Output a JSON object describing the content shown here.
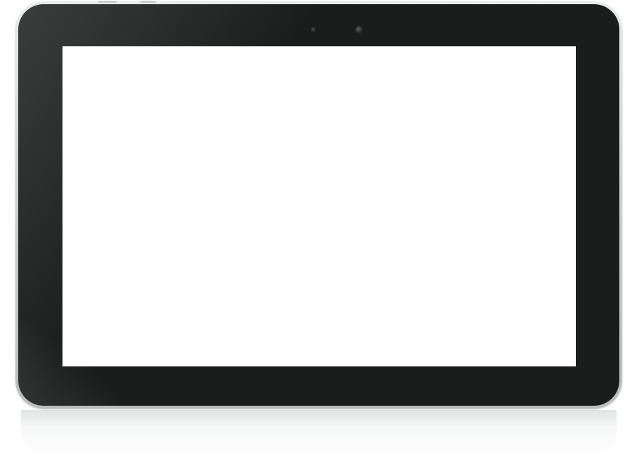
{
  "device": {
    "type": "tablet",
    "orientation": "landscape",
    "frame_color": "#c9cdcc",
    "bezel_color": "#1b1d1c",
    "screen_color": "#ffffff",
    "screen_content": ""
  },
  "icons": {
    "camera": "camera-lens",
    "sensor": "proximity-sensor"
  }
}
